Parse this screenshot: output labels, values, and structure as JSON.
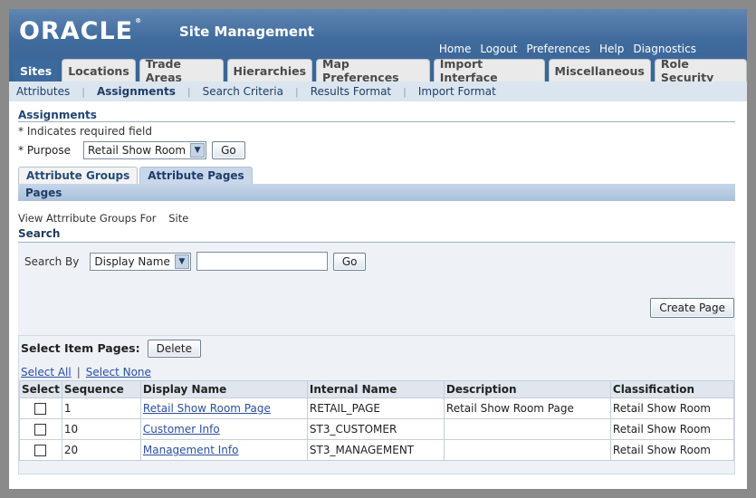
{
  "header": {
    "logo": "ORACLE",
    "app_title": "Site Management",
    "global_links": [
      "Home",
      "Logout",
      "Preferences",
      "Help",
      "Diagnostics"
    ]
  },
  "tabs": [
    "Sites",
    "Locations",
    "Trade Areas",
    "Hierarchies",
    "Map Preferences",
    "Import Interface",
    "Miscellaneous",
    "Role Security"
  ],
  "active_tab": "Sites",
  "subtabs": [
    "Attributes",
    "Assignments",
    "Search Criteria",
    "Results Format",
    "Import Format"
  ],
  "active_subtab": "Assignments",
  "page": {
    "title": "Assignments",
    "required_note": "* Indicates required field",
    "purpose_label": "* Purpose",
    "purpose_value": "Retail Show Room",
    "go_label": "Go"
  },
  "page_tabs": [
    "Attribute Groups",
    "Attribute Pages"
  ],
  "active_page_tab": "Attribute Pages",
  "pages_section": {
    "title": "Pages",
    "view_label": "View Attrribute Groups For",
    "view_value": "Site"
  },
  "search": {
    "title": "Search",
    "search_by_label": "Search By",
    "search_by_value": "Display Name",
    "search_value": "",
    "go_label": "Go",
    "create_page_label": "Create Page"
  },
  "table": {
    "select_label": "Select Item Pages:",
    "delete_label": "Delete",
    "select_all": "Select All",
    "select_none": "Select None",
    "columns": [
      "Select",
      "Sequence",
      "Display Name",
      "Internal Name",
      "Description",
      "Classification"
    ],
    "rows": [
      {
        "sequence": "1",
        "display_name": "Retail Show Room Page",
        "internal_name": "RETAIL_PAGE",
        "description": "Retail Show Room Page",
        "classification": "Retail Show Room"
      },
      {
        "sequence": "10",
        "display_name": "Customer Info",
        "internal_name": "ST3_CUSTOMER",
        "description": "",
        "classification": "Retail Show Room"
      },
      {
        "sequence": "20",
        "display_name": "Management Info",
        "internal_name": "ST3_MANAGEMENT",
        "description": "",
        "classification": "Retail Show Room"
      }
    ]
  }
}
